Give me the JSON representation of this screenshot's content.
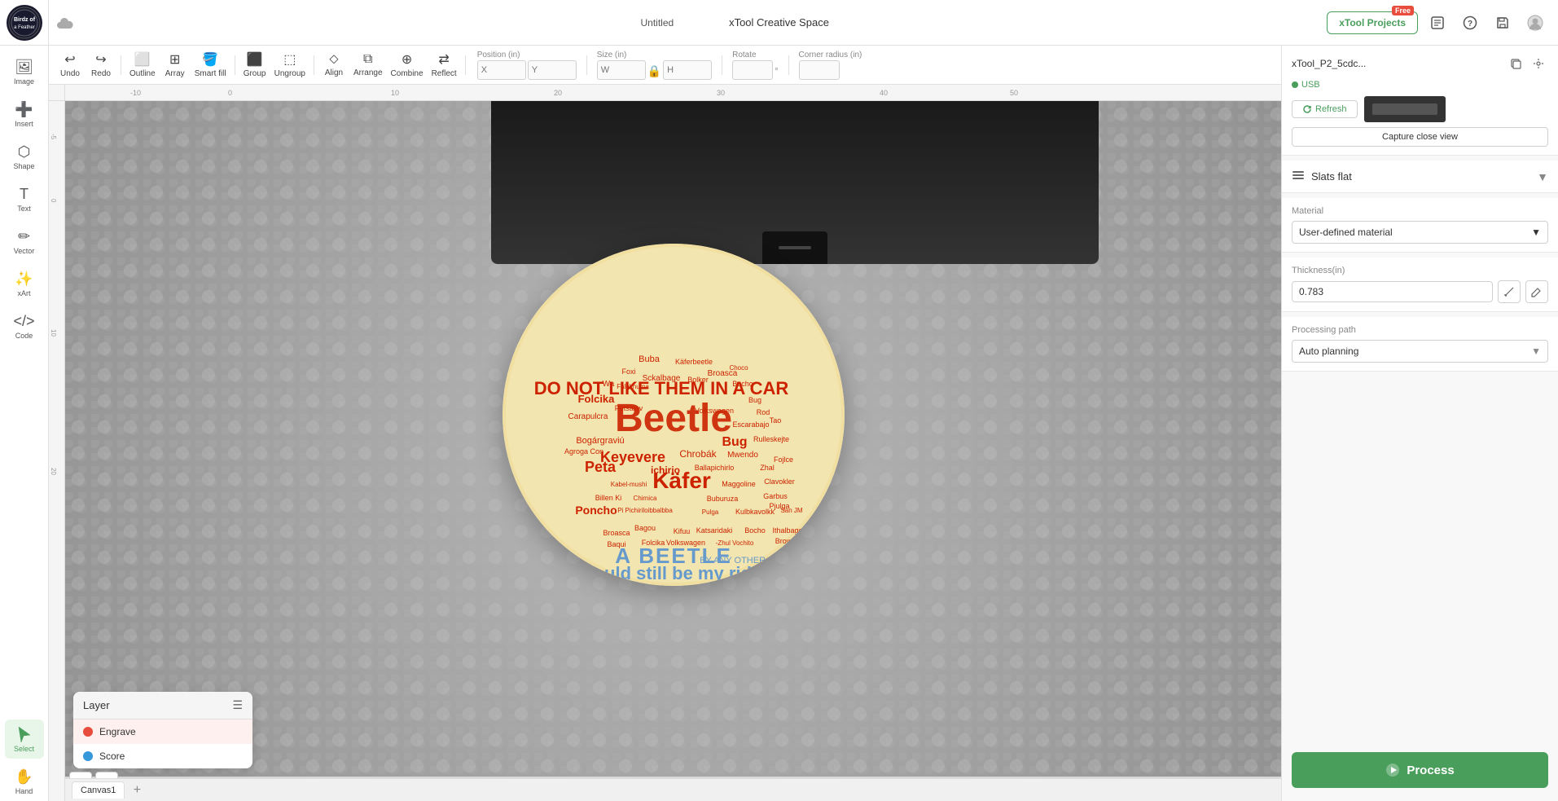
{
  "app": {
    "title": "xTool Creative Space",
    "doc_title": "Untitled"
  },
  "header": {
    "xtool_projects_label": "xTool Projects",
    "free_badge": "Free"
  },
  "toolbar": {
    "undo_label": "Undo",
    "redo_label": "Redo",
    "outline_label": "Outline",
    "array_label": "Array",
    "smart_fill_label": "Smart fill",
    "group_label": "Group",
    "ungroup_label": "Ungroup",
    "align_label": "Align",
    "arrange_label": "Arrange",
    "combine_label": "Combine",
    "reflect_label": "Reflect",
    "position_label": "Position (in)",
    "size_label": "Size (in)",
    "rotate_label": "Rotate",
    "corner_radius_label": "Corner radius (in)",
    "x_placeholder": "X",
    "y_placeholder": "Y",
    "w_placeholder": "W",
    "h_placeholder": "H"
  },
  "left_sidebar": {
    "image_label": "Image",
    "insert_label": "Insert",
    "shape_label": "Shape",
    "text_label": "Text",
    "vector_label": "Vector",
    "xart_label": "xArt",
    "code_label": "Code",
    "select_label": "Select",
    "hand_label": "Hand"
  },
  "right_panel": {
    "device_name": "xTool_P2_5cdc...",
    "usb_label": "USB",
    "refresh_label": "Refresh",
    "capture_label": "Capture close view",
    "slats_label": "Slats flat",
    "material_section_label": "Material",
    "material_value": "User-defined material",
    "thickness_label": "Thickness(in)",
    "thickness_value": "0.783",
    "processing_path_label": "Processing path",
    "auto_planning_label": "Auto planning",
    "process_btn_label": "Process"
  },
  "layers": {
    "title": "Layer",
    "items": [
      {
        "name": "Engrave",
        "color": "red",
        "active": true
      },
      {
        "name": "Score",
        "color": "blue",
        "active": false
      }
    ]
  },
  "canvas": {
    "tab_label": "Canvas1",
    "add_tab_label": "+"
  }
}
